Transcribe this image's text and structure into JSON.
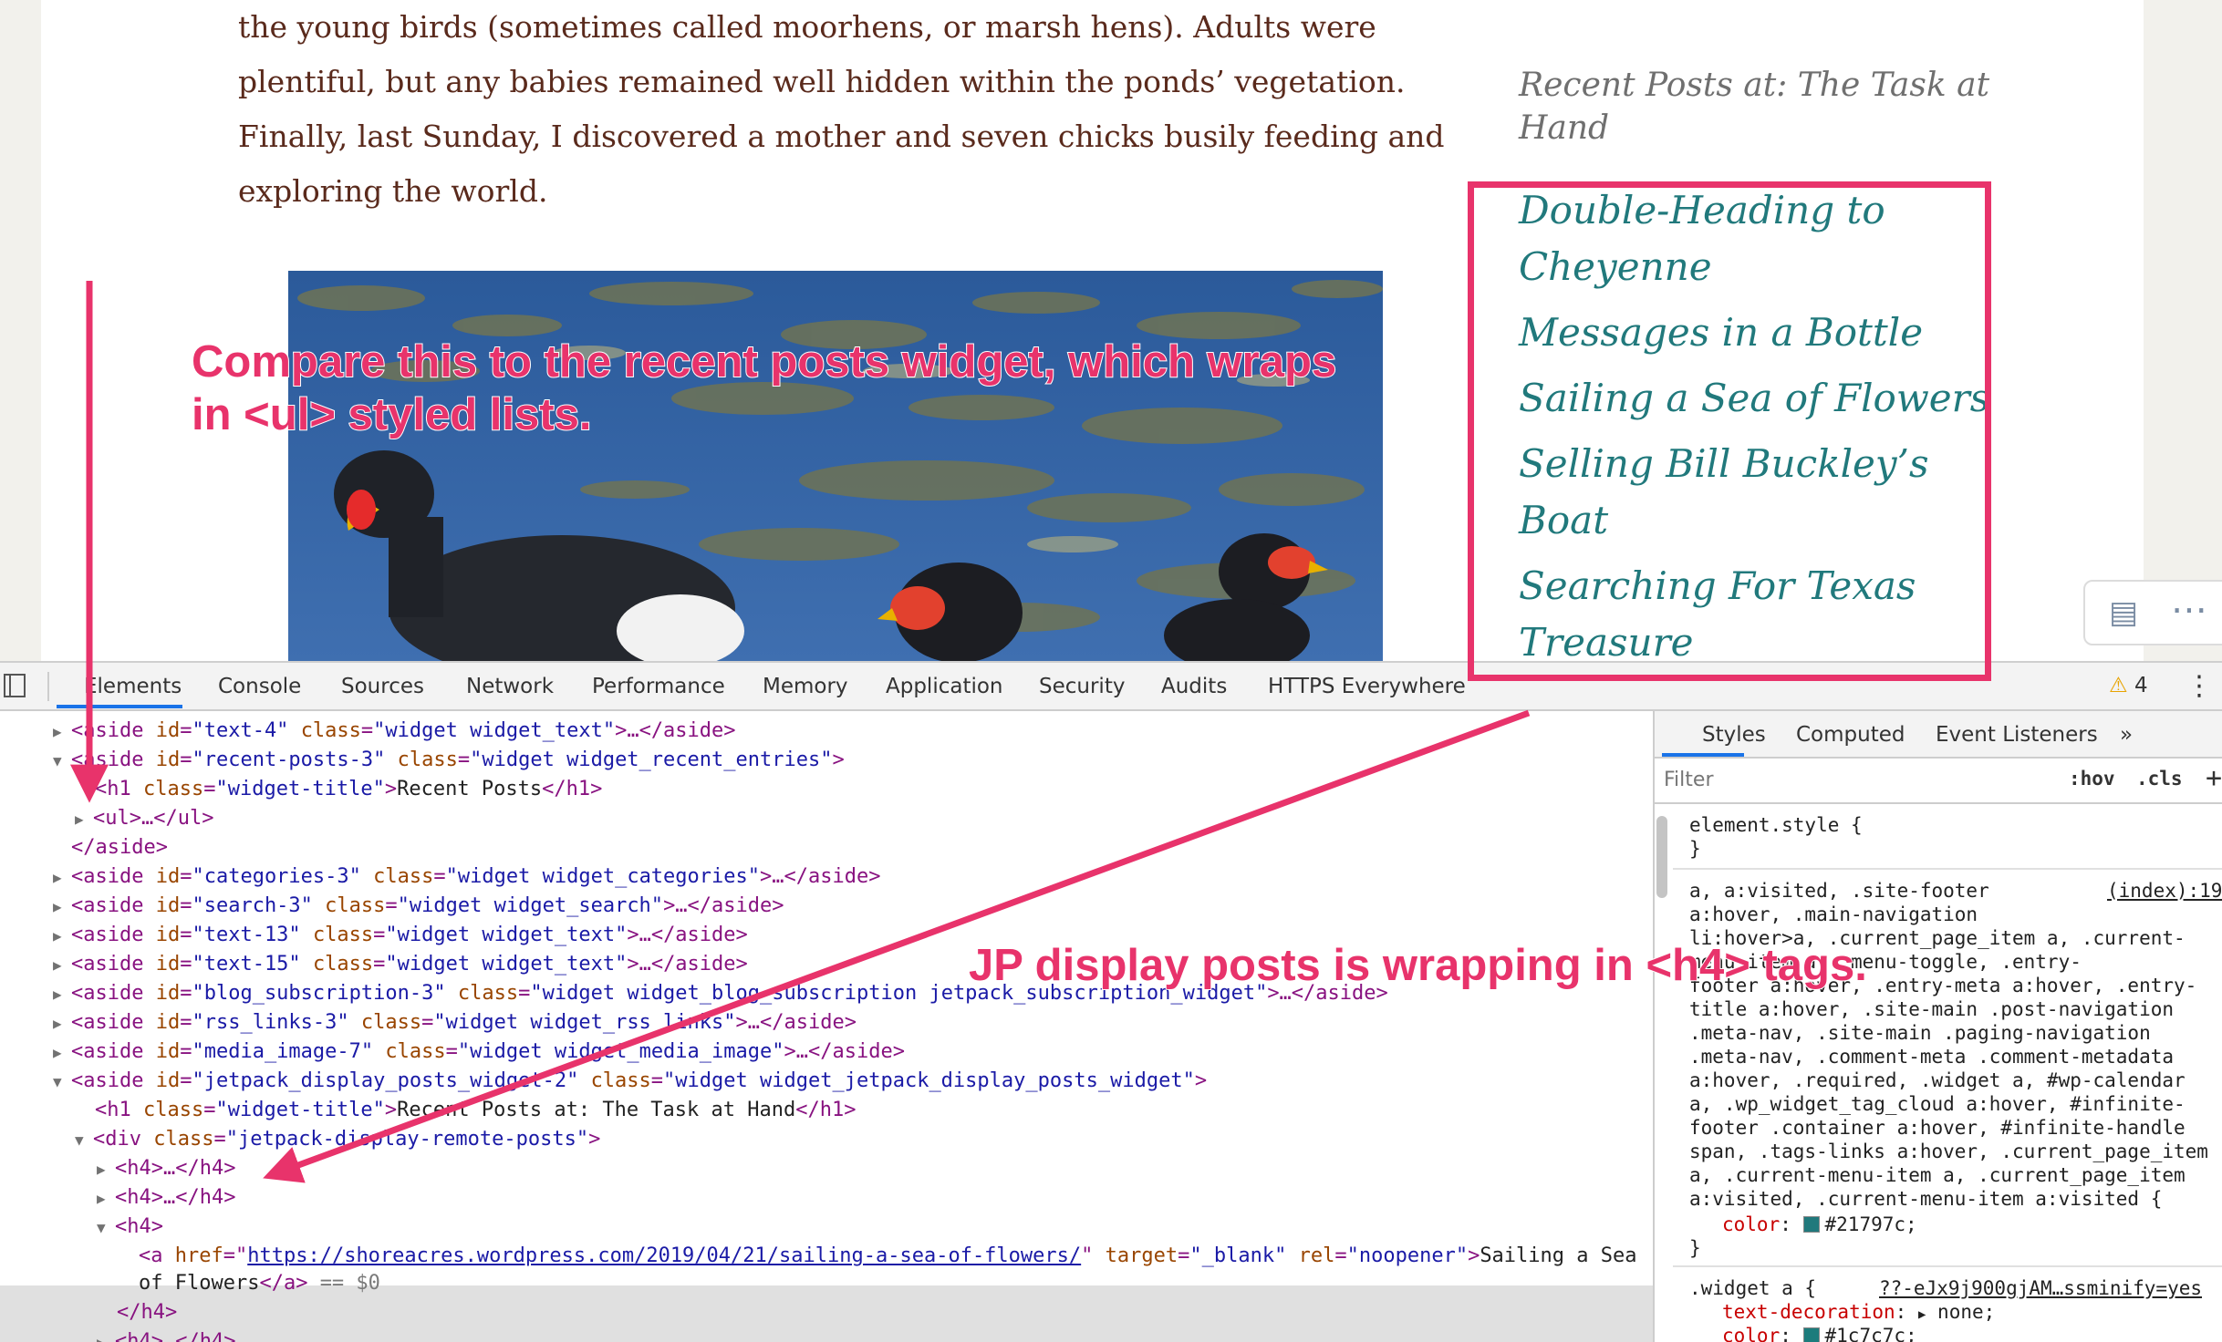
{
  "article": {
    "lines": [
      "the young birds (sometimes called moorhens, or marsh hens). Adults were",
      "plentiful, but any babies remained well hidden within the ponds’ vegetation.",
      "Finally, last Sunday, I discovered a mother and seven chicks busily feeding and",
      "exploring the world."
    ]
  },
  "sidebar": {
    "widget_title": "Recent Posts at: The Task at Hand",
    "posts": [
      "Double-Heading to Cheyenne",
      "Messages in a Bottle",
      "Sailing a Sea of Flowers",
      "Selling Bill Buckley’s Boat",
      "Searching For Texas Treasure"
    ]
  },
  "annotations": {
    "note_1_line1": "Compare this to the recent posts widget, which wraps",
    "note_1_line2": "in <ul> styled lists.",
    "note_2": "JP display posts is wrapping in <h4> tags."
  },
  "devtools": {
    "tabs": [
      "Elements",
      "Console",
      "Sources",
      "Network",
      "Performance",
      "Memory",
      "Application",
      "Security",
      "Audits",
      "HTTPS Everywhere"
    ],
    "active_tab": "Elements",
    "warning_count": "4",
    "styles_tabs": [
      "Styles",
      "Computed",
      "Event Listeners",
      "»"
    ],
    "filter_placeholder": "Filter",
    "hov": ":hov",
    "cls": ".cls",
    "dom": {
      "aside_text4": {
        "id": "\"text-4\"",
        "class": "\"widget widget_text\""
      },
      "aside_recent": {
        "id": "\"recent-posts-3\"",
        "class": "\"widget widget_recent_entries\""
      },
      "h1_recent": {
        "class": "\"widget-title\"",
        "text": "Recent Posts"
      },
      "aside_categories": {
        "id": "\"categories-3\"",
        "class": "\"widget widget_categories\""
      },
      "aside_search": {
        "id": "\"search-3\"",
        "class": "\"widget widget_search\""
      },
      "aside_text13": {
        "id": "\"text-13\"",
        "class": "\"widget widget_text\""
      },
      "aside_text15": {
        "id": "\"text-15\"",
        "class": "\"widget widget_text\""
      },
      "aside_blog_sub": {
        "id": "\"blog_subscription-3\"",
        "class": "\"widget widget_blog_subscription jetpack_subscription_widget\""
      },
      "aside_rss": {
        "id": "\"rss_links-3\"",
        "class": "\"widget widget_rss_links\""
      },
      "aside_media": {
        "id": "\"media_image-7\"",
        "class": "\"widget widget_media_image\""
      },
      "aside_jetpack": {
        "id": "\"jetpack_display_posts_widget-2\"",
        "class": "\"widget widget_jetpack_display_posts_widget\""
      },
      "h1_jetpack": {
        "class": "\"widget-title\"",
        "text": "Recent Posts at: The Task at Hand"
      },
      "div_remote": {
        "class": "\"jetpack-display-remote-posts\""
      },
      "selected_a": {
        "href": "https://shoreacres.wordpress.com/2019/04/21/sailing-a-sea-of-flowers/",
        "target": "\"_blank\"",
        "rel": "\"noopener\"",
        "text_line1": "Sailing a Sea",
        "text_line2": "of Flowers",
        "marker": "== $0"
      }
    },
    "styles": {
      "element_style": "element.style {",
      "close_brace": "}",
      "rule1_source": "(index):19",
      "rule1_selectors": [
        "a, a:visited, .site-footer",
        "a:hover, .main-navigation",
        "li:hover>a, .current_page_item a, .current-",
        "menu-item a, .menu-toggle, .entry-",
        "footer a:hover, .entry-meta a:hover, .entry-",
        "title a:hover, .site-main .post-navigation",
        ".meta-nav, .site-main .paging-navigation",
        ".meta-nav, .comment-meta .comment-metadata",
        "a:hover, .required, .widget a, #wp-calendar",
        "a, .wp_widget_tag_cloud a:hover, #infinite-",
        "footer .container a:hover, #infinite-handle",
        "span, .tags-links a:hover, .current_page_item",
        "a, .current-menu-item a, .current_page_item",
        "a:visited, .current-menu-item a:visited {"
      ],
      "rule1_prop": "color",
      "rule1_value": "#21797c;",
      "rule2_selector": ".widget a {",
      "rule2_source": "??-eJx9j900gjAM…ssminify=yes",
      "rule2_prop": "text-decoration",
      "rule2_value": "none;",
      "rule2_prop2": "color",
      "rule2_value2": "#1c7c7c;"
    }
  },
  "colors": {
    "accent_pink": "#e8336b",
    "link_teal": "#21797c",
    "article_text": "#5a2a1c",
    "devtools_blue": "#1a73e8"
  }
}
